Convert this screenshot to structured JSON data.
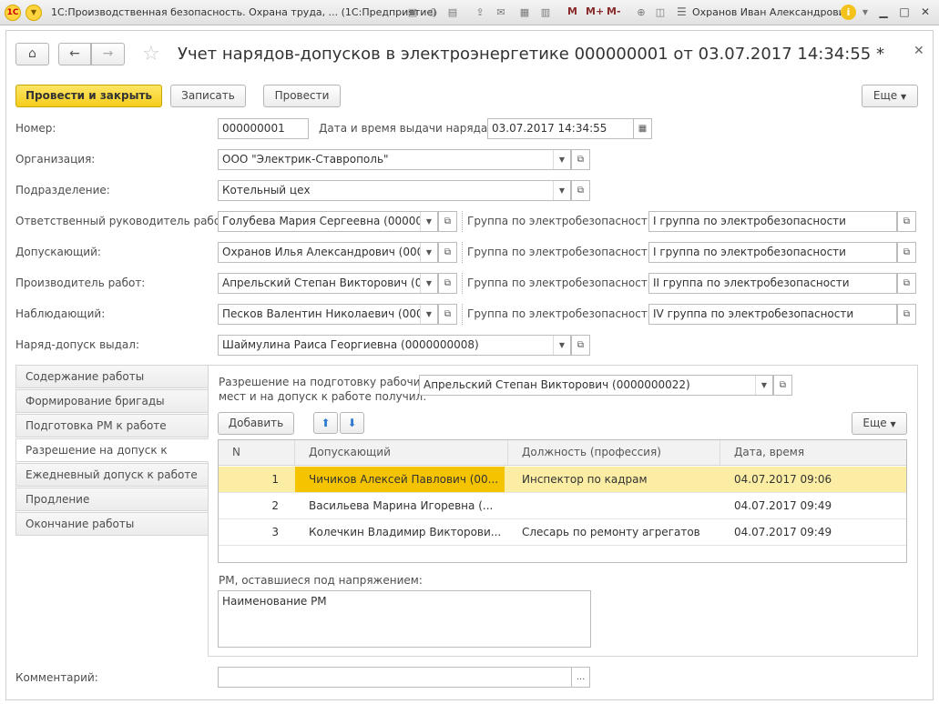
{
  "titlebar": {
    "app_title": "1С:Производственная безопасность. Охрана труда, ...  (1С:Предприятие)",
    "m": "M",
    "mplus": "M+",
    "mminus": "M-",
    "user": "Охранов Иван Александрович"
  },
  "form": {
    "title": "Учет нарядов-допусков в электроэнергетике 000000001 от 03.07.2017 14:34:55 *",
    "buttons": {
      "post_close": "Провести и закрыть",
      "write": "Записать",
      "post": "Провести",
      "more": "Еще"
    },
    "number_label": "Номер:",
    "number_value": "000000001",
    "datetime_label": "Дата и время выдачи наряда:",
    "datetime_value": "03.07.2017 14:34:55",
    "org_label": "Организация:",
    "org_value": "ООО \"Электрик-Ставрополь\"",
    "dept_label": "Подразделение:",
    "dept_value": "Котельный цех",
    "rows": [
      {
        "label": "Ответственный руководитель работ:",
        "value": "Голубева  Мария   Сергеевна (00000",
        "group_label": "Группа по электробезопасности:",
        "group_value": "I группа по электробезопасности"
      },
      {
        "label": "Допускающий:",
        "value": "Охранов Илья Александрович (0000",
        "group_label": "Группа по электробезопасности:",
        "group_value": "I группа по электробезопасности"
      },
      {
        "label": "Производитель работ:",
        "value": "Апрельский Степан Викторович (000",
        "group_label": "Группа по электробезопасности:",
        "group_value": "II группа по электробезопасности"
      },
      {
        "label": "Наблюдающий:",
        "value": "Песков Валентин Николаевич (0000",
        "group_label": "Группа по электробезопасности:",
        "group_value": "IV группа по электробезопасности"
      }
    ],
    "issued_label": "Наряд-допуск выдал:",
    "issued_value": "Шаймулина Раиса Георгиевна (0000000008)",
    "comment_label": "Комментарий:",
    "comment_btn": "..."
  },
  "tabs": [
    "Содержание работы",
    "Формирование бригады",
    "Подготовка РМ к работе",
    "Разрешение на допуск к работе",
    "Ежедневный допуск к работе",
    "Продление",
    "Окончание работы"
  ],
  "panel": {
    "permission_label_1": "Разрешение на подготовку рабочих",
    "permission_label_2": "мест и на допуск к работе получил:",
    "permission_value": "Апрельский Степан Викторович (0000000022)",
    "add_button": "Добавить",
    "more_button": "Еще",
    "columns": [
      "N",
      "Допускающий",
      "Должность (профессия)",
      "Дата, время"
    ],
    "table_rows": [
      {
        "n": "1",
        "person": "Чичиков Алексей Павлович (00...",
        "position": "Инспектор по кадрам",
        "datetime": "04.07.2017 09:06"
      },
      {
        "n": "2",
        "person": "Васильева Марина Игоревна (...",
        "position": "",
        "datetime": "04.07.2017 09:49"
      },
      {
        "n": "3",
        "person": "Колечкин Владимир Викторови...",
        "position": "Слесарь по ремонту агрегатов",
        "datetime": "04.07.2017 09:49"
      }
    ],
    "rm_label": "РМ, оставшиеся под напряжением:",
    "rm_value": "Наименование РМ"
  }
}
